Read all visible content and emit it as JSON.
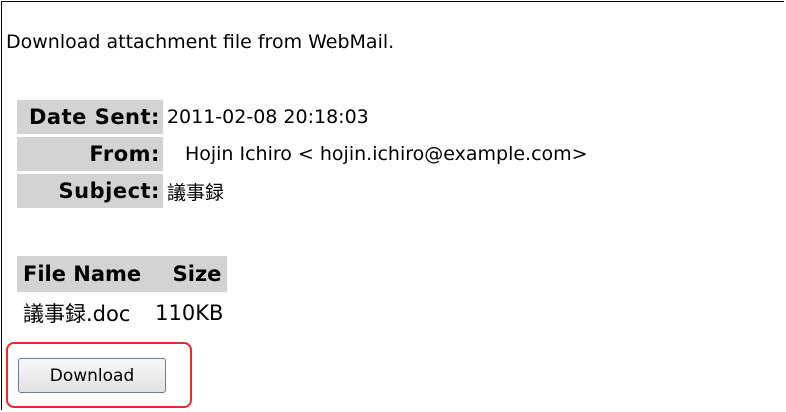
{
  "intro_text": "Download attachment file from WebMail.",
  "mail_info": {
    "date_sent_label": "Date Sent:",
    "date_sent_value": "2011-02-08 20:18:03",
    "from_label": "From:",
    "from_value": "Hojin Ichiro < hojin.ichiro@example.com>",
    "subject_label": "Subject:",
    "subject_value": "議事録"
  },
  "attachments": {
    "headers": {
      "file_name": "File Name",
      "size": "Size"
    },
    "rows": [
      {
        "file_name": "議事録.doc",
        "size": "110KB"
      }
    ]
  },
  "download_button_label": "Download",
  "colors": {
    "label_background": "#d3d3d3",
    "highlight_border": "#e8282d"
  }
}
